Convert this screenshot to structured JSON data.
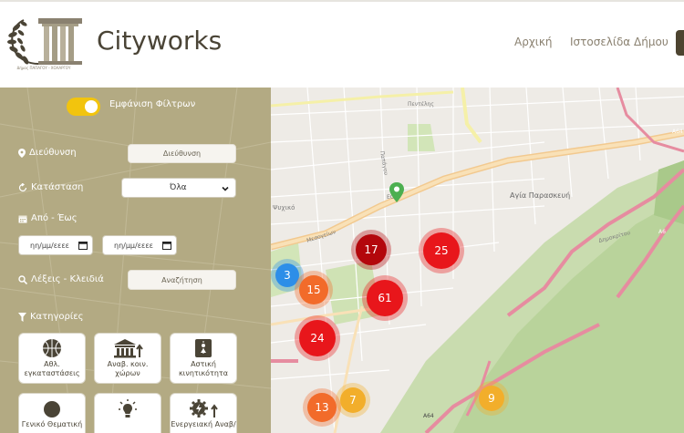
{
  "header": {
    "brand": "Cityworks",
    "logo_caption": "Δήμος ΠΑΠΑΓΟΥ - ΧΟΛΑΡΓΟΥ",
    "nav": {
      "home": "Αρχική",
      "municipality": "Ιστοσελίδα Δήμου"
    }
  },
  "sidebar": {
    "toggle_label": "Εμφάνιση Φίλτρων",
    "toggle_on": true,
    "address_label": "Διεύθυνση",
    "address_placeholder": "Διεύθυνση",
    "status_label": "Κατάσταση",
    "status_value": "Όλα",
    "date_label": "Από - Έως",
    "date_from_placeholder": "ηη/μμ/εεεε",
    "date_to_placeholder": "ηη/μμ/εεεε",
    "keywords_label": "Λέξεις - Κλειδιά",
    "keywords_placeholder": "Αναζήτηση",
    "categories_label": "Κατηγορίες",
    "categories": [
      {
        "label_1": "Αθλ.",
        "label_2": "εγκαταστάσεις",
        "icon": "basketball-icon"
      },
      {
        "label_1": "Αναβ. κοιν.",
        "label_2": "χώρων",
        "icon": "public-building-upgrade-icon"
      },
      {
        "label_1": "Αστική",
        "label_2": "κινητικότητα",
        "icon": "urban-mobility-icon"
      },
      {
        "label_1": "Γενικό Θεματική",
        "label_2": "",
        "icon": "circle-icon"
      },
      {
        "label_1": "",
        "label_2": "",
        "icon": "lightbulb-icon"
      },
      {
        "label_1": "Ενεργειακή Αναβ/",
        "label_2": "",
        "icon": "energy-upgrade-icon"
      }
    ]
  },
  "map": {
    "clusters": [
      {
        "count": "17",
        "color": "#b3070c"
      },
      {
        "count": "25",
        "color": "#e8161b"
      },
      {
        "count": "3",
        "color": "#2d8ee8"
      },
      {
        "count": "15",
        "color": "#f26b2a"
      },
      {
        "count": "61",
        "color": "#e8161b"
      },
      {
        "count": "24",
        "color": "#e8161b"
      },
      {
        "count": "7",
        "color": "#f2ae2b"
      },
      {
        "count": "13",
        "color": "#f26b2a"
      },
      {
        "count": "9",
        "color": "#f2ae2b"
      }
    ],
    "labels": {
      "agia_paraskevi": "Αγία Παρασκευή",
      "ekav": "ΕΟ",
      "psychiko": "Ψυχικό",
      "mesogeion": "Μεσογείων",
      "tatoiou": "Πεντέλης",
      "papagou": "Παπάγου",
      "a64": "A64",
      "a64b": "A64",
      "a6": "A6",
      "dimokritou": "Δημοκρίτου"
    },
    "marker_color": "#4caf50"
  }
}
